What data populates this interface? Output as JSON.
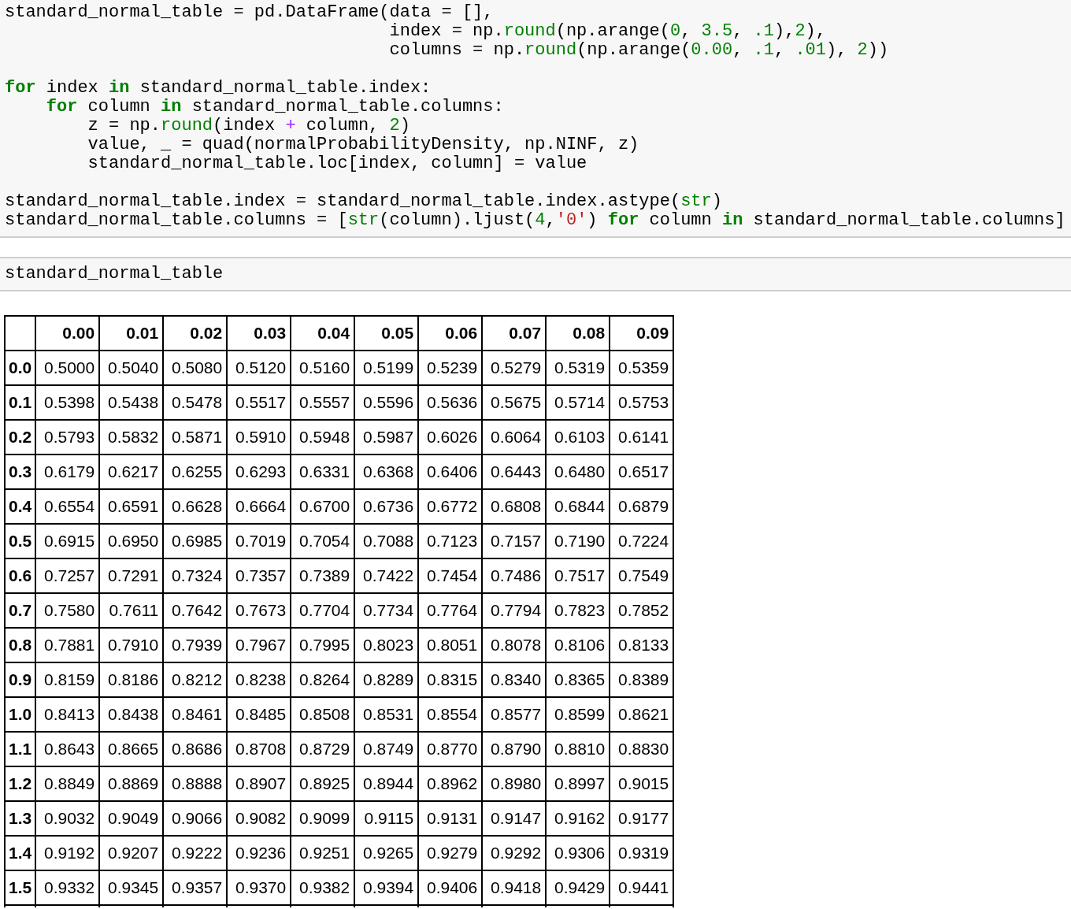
{
  "code_cells": [
    {
      "blocks": [
        [
          {
            "tokens": [
              {
                "kind": "plain",
                "text": "standard_normal_table = pd.DataFrame(data = [],"
              }
            ]
          },
          {
            "tokens": [
              {
                "kind": "plain",
                "text": "                                     index = np."
              },
              {
                "kind": "builtin",
                "text": "round"
              },
              {
                "kind": "plain",
                "text": "(np.arange("
              },
              {
                "kind": "number",
                "text": "0"
              },
              {
                "kind": "plain",
                "text": ", "
              },
              {
                "kind": "number",
                "text": "3.5"
              },
              {
                "kind": "plain",
                "text": ", "
              },
              {
                "kind": "number",
                "text": ".1"
              },
              {
                "kind": "plain",
                "text": "),"
              },
              {
                "kind": "number",
                "text": "2"
              },
              {
                "kind": "plain",
                "text": "),"
              }
            ]
          },
          {
            "tokens": [
              {
                "kind": "plain",
                "text": "                                     columns = np."
              },
              {
                "kind": "builtin",
                "text": "round"
              },
              {
                "kind": "plain",
                "text": "(np.arange("
              },
              {
                "kind": "number",
                "text": "0.00"
              },
              {
                "kind": "plain",
                "text": ", "
              },
              {
                "kind": "number",
                "text": ".1"
              },
              {
                "kind": "plain",
                "text": ", "
              },
              {
                "kind": "number",
                "text": ".01"
              },
              {
                "kind": "plain",
                "text": "), "
              },
              {
                "kind": "number",
                "text": "2"
              },
              {
                "kind": "plain",
                "text": "))"
              }
            ]
          }
        ],
        [
          {
            "tokens": [
              {
                "kind": "keyword",
                "text": "for"
              },
              {
                "kind": "plain",
                "text": " index "
              },
              {
                "kind": "keyword",
                "text": "in"
              },
              {
                "kind": "plain",
                "text": " standard_normal_table.index:"
              }
            ],
            "children": [
              {
                "tokens": [
                  {
                    "kind": "keyword",
                    "text": "for"
                  },
                  {
                    "kind": "plain",
                    "text": " column "
                  },
                  {
                    "kind": "keyword",
                    "text": "in"
                  },
                  {
                    "kind": "plain",
                    "text": " standard_normal_table.columns:"
                  }
                ],
                "children": [
                  {
                    "tokens": [
                      {
                        "kind": "plain",
                        "text": "z = np."
                      },
                      {
                        "kind": "builtin",
                        "text": "round"
                      },
                      {
                        "kind": "plain",
                        "text": "(index "
                      },
                      {
                        "kind": "operator",
                        "text": "+"
                      },
                      {
                        "kind": "plain",
                        "text": " column, "
                      },
                      {
                        "kind": "number",
                        "text": "2"
                      },
                      {
                        "kind": "plain",
                        "text": ")"
                      }
                    ]
                  },
                  {
                    "tokens": [
                      {
                        "kind": "plain",
                        "text": "value, _ = quad(normalProbabilityDensity, np.NINF, z)"
                      }
                    ]
                  },
                  {
                    "tokens": [
                      {
                        "kind": "plain",
                        "text": "standard_normal_table.loc[index, column] = value"
                      }
                    ]
                  }
                ]
              }
            ]
          }
        ],
        [
          {
            "tokens": [
              {
                "kind": "plain",
                "text": "standard_normal_table.index = standard_normal_table.index.astype("
              },
              {
                "kind": "builtin",
                "text": "str"
              },
              {
                "kind": "plain",
                "text": ")"
              }
            ]
          },
          {
            "tokens": [
              {
                "kind": "plain",
                "text": "standard_normal_table.columns = ["
              },
              {
                "kind": "builtin",
                "text": "str"
              },
              {
                "kind": "plain",
                "text": "(column).ljust("
              },
              {
                "kind": "number",
                "text": "4"
              },
              {
                "kind": "plain",
                "text": ","
              },
              {
                "kind": "string",
                "text": "'0'"
              },
              {
                "kind": "plain",
                "text": ") "
              },
              {
                "kind": "keyword",
                "text": "for"
              },
              {
                "kind": "plain",
                "text": " column "
              },
              {
                "kind": "keyword",
                "text": "in"
              },
              {
                "kind": "plain",
                "text": " standard_normal_table.columns]"
              }
            ]
          }
        ]
      ]
    },
    {
      "blocks": [
        [
          {
            "tokens": [
              {
                "kind": "plain",
                "text": "standard_normal_table"
              }
            ]
          }
        ]
      ]
    }
  ],
  "table": {
    "columns": [
      "0.00",
      "0.01",
      "0.02",
      "0.03",
      "0.04",
      "0.05",
      "0.06",
      "0.07",
      "0.08",
      "0.09"
    ],
    "rows": [
      {
        "index": "0.0",
        "values": [
          "0.5000",
          "0.5040",
          "0.5080",
          "0.5120",
          "0.5160",
          "0.5199",
          "0.5239",
          "0.5279",
          "0.5319",
          "0.5359"
        ]
      },
      {
        "index": "0.1",
        "values": [
          "0.5398",
          "0.5438",
          "0.5478",
          "0.5517",
          "0.5557",
          "0.5596",
          "0.5636",
          "0.5675",
          "0.5714",
          "0.5753"
        ]
      },
      {
        "index": "0.2",
        "values": [
          "0.5793",
          "0.5832",
          "0.5871",
          "0.5910",
          "0.5948",
          "0.5987",
          "0.6026",
          "0.6064",
          "0.6103",
          "0.6141"
        ]
      },
      {
        "index": "0.3",
        "values": [
          "0.6179",
          "0.6217",
          "0.6255",
          "0.6293",
          "0.6331",
          "0.6368",
          "0.6406",
          "0.6443",
          "0.6480",
          "0.6517"
        ]
      },
      {
        "index": "0.4",
        "values": [
          "0.6554",
          "0.6591",
          "0.6628",
          "0.6664",
          "0.6700",
          "0.6736",
          "0.6772",
          "0.6808",
          "0.6844",
          "0.6879"
        ]
      },
      {
        "index": "0.5",
        "values": [
          "0.6915",
          "0.6950",
          "0.6985",
          "0.7019",
          "0.7054",
          "0.7088",
          "0.7123",
          "0.7157",
          "0.7190",
          "0.7224"
        ]
      },
      {
        "index": "0.6",
        "values": [
          "0.7257",
          "0.7291",
          "0.7324",
          "0.7357",
          "0.7389",
          "0.7422",
          "0.7454",
          "0.7486",
          "0.7517",
          "0.7549"
        ]
      },
      {
        "index": "0.7",
        "values": [
          "0.7580",
          "0.7611",
          "0.7642",
          "0.7673",
          "0.7704",
          "0.7734",
          "0.7764",
          "0.7794",
          "0.7823",
          "0.7852"
        ]
      },
      {
        "index": "0.8",
        "values": [
          "0.7881",
          "0.7910",
          "0.7939",
          "0.7967",
          "0.7995",
          "0.8023",
          "0.8051",
          "0.8078",
          "0.8106",
          "0.8133"
        ]
      },
      {
        "index": "0.9",
        "values": [
          "0.8159",
          "0.8186",
          "0.8212",
          "0.8238",
          "0.8264",
          "0.8289",
          "0.8315",
          "0.8340",
          "0.8365",
          "0.8389"
        ]
      },
      {
        "index": "1.0",
        "values": [
          "0.8413",
          "0.8438",
          "0.8461",
          "0.8485",
          "0.8508",
          "0.8531",
          "0.8554",
          "0.8577",
          "0.8599",
          "0.8621"
        ]
      },
      {
        "index": "1.1",
        "values": [
          "0.8643",
          "0.8665",
          "0.8686",
          "0.8708",
          "0.8729",
          "0.8749",
          "0.8770",
          "0.8790",
          "0.8810",
          "0.8830"
        ]
      },
      {
        "index": "1.2",
        "values": [
          "0.8849",
          "0.8869",
          "0.8888",
          "0.8907",
          "0.8925",
          "0.8944",
          "0.8962",
          "0.8980",
          "0.8997",
          "0.9015"
        ]
      },
      {
        "index": "1.3",
        "values": [
          "0.9032",
          "0.9049",
          "0.9066",
          "0.9082",
          "0.9099",
          "0.9115",
          "0.9131",
          "0.9147",
          "0.9162",
          "0.9177"
        ]
      },
      {
        "index": "1.4",
        "values": [
          "0.9192",
          "0.9207",
          "0.9222",
          "0.9236",
          "0.9251",
          "0.9265",
          "0.9279",
          "0.9292",
          "0.9306",
          "0.9319"
        ]
      },
      {
        "index": "1.5",
        "values": [
          "0.9332",
          "0.9345",
          "0.9357",
          "0.9370",
          "0.9382",
          "0.9394",
          "0.9406",
          "0.9418",
          "0.9429",
          "0.9441"
        ]
      }
    ]
  }
}
